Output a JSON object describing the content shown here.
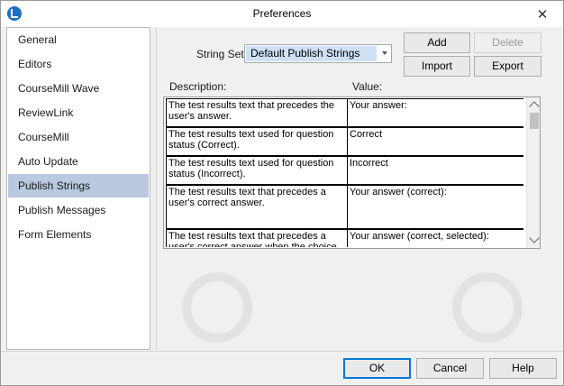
{
  "window": {
    "title": "Preferences",
    "close_glyph": "✕"
  },
  "sidebar": {
    "items": [
      {
        "label": "General",
        "selected": false
      },
      {
        "label": "Editors",
        "selected": false
      },
      {
        "label": "CourseMill Wave",
        "selected": false
      },
      {
        "label": "ReviewLink",
        "selected": false
      },
      {
        "label": "CourseMill",
        "selected": false
      },
      {
        "label": "Auto Update",
        "selected": false
      },
      {
        "label": "Publish Strings",
        "selected": true
      },
      {
        "label": "Publish Messages",
        "selected": false
      },
      {
        "label": "Form Elements",
        "selected": false
      }
    ]
  },
  "main": {
    "string_set_label": "String Set:",
    "string_set_value": "Default Publish Strings",
    "buttons": {
      "add": "Add",
      "delete": "Delete",
      "import": "Import",
      "export": "Export"
    },
    "column_description": "Description:",
    "column_value": "Value:",
    "rows": [
      {
        "description": "The test results text that precedes the user's answer.",
        "value": "Your answer:"
      },
      {
        "description": "The test results text used for question status (Correct).",
        "value": "Correct"
      },
      {
        "description": "The test results text used for question status (Incorrect).",
        "value": "Incorrect"
      },
      {
        "description": "The test results text that precedes a user's correct answer.",
        "value": "Your answer (correct):"
      },
      {
        "description": "The test results text that precedes a user's correct answer when the choice is",
        "value": "Your answer (correct, selected):"
      }
    ]
  },
  "footer": {
    "ok": "OK",
    "cancel": "Cancel",
    "help": "Help"
  },
  "colors": {
    "selected_nav": "#b8c9e0",
    "select_highlight": "#cfe0f6",
    "ok_border": "#0078d7"
  }
}
